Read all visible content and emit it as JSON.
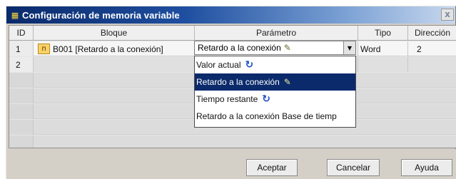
{
  "window": {
    "title": "Configuración de memoria variable",
    "close_label": "x"
  },
  "columns": [
    "ID",
    "Bloque",
    "Parámetro",
    "Tipo",
    "Dirección"
  ],
  "rows": [
    {
      "id": "1",
      "block_icon": "timer-block-icon",
      "block": "B001 [Retardo a la conexión]",
      "type": "Word",
      "address": "2"
    },
    {
      "id": "2"
    }
  ],
  "combo": {
    "value": "Retardo a la conexión",
    "icon": "edit-icon"
  },
  "dropdown": {
    "options": [
      {
        "label": "Valor actual",
        "icon": "refresh-icon"
      },
      {
        "label": "Retardo a la conexión",
        "icon": "edit-icon"
      },
      {
        "label": "Tiempo restante",
        "icon": "refresh-icon"
      },
      {
        "label": "Retardo a la conexión Base de tiemp",
        "icon": ""
      }
    ],
    "selected_index": 1
  },
  "buttons": {
    "ok": "Aceptar",
    "cancel": "Cancelar",
    "help": "Ayuda"
  },
  "colors": {
    "title_start": "#0a2a6b",
    "selection": "#0a2a6b",
    "refresh_icon": "#1d4ec8"
  }
}
